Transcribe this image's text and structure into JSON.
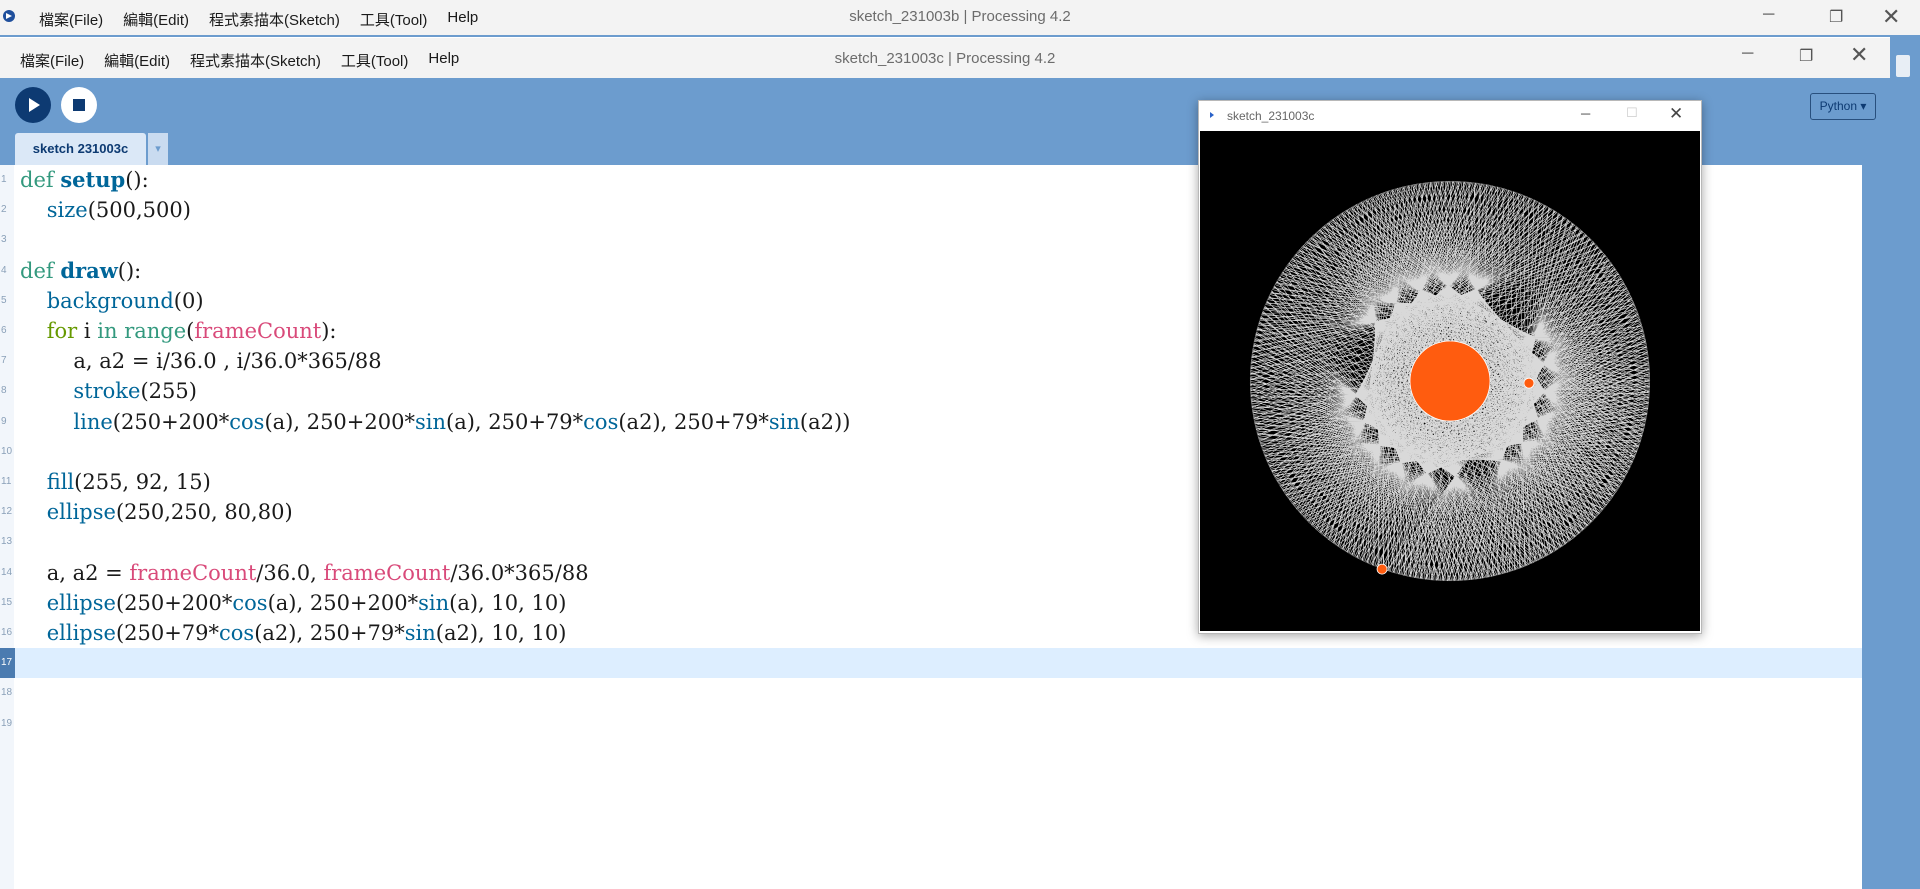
{
  "back_window": {
    "title": "sketch_231003b | Processing 4.2",
    "menu": [
      "檔案(File)",
      "編輯(Edit)",
      "程式素描本(Sketch)",
      "工具(Tool)",
      "Help"
    ],
    "controls": {
      "minimize": "─",
      "maximize": "❐",
      "close": "✕"
    }
  },
  "front_window": {
    "title": "sketch_231003c | Processing 4.2",
    "menu": [
      "檔案(File)",
      "編輯(Edit)",
      "程式素描本(Sketch)",
      "工具(Tool)",
      "Help"
    ],
    "controls": {
      "minimize": "─",
      "maximize": "❐",
      "close": "✕"
    }
  },
  "toolbar": {
    "mode_label": "Python ▾",
    "colors": {
      "bar": "#6c9cce",
      "run": "#0d3a72"
    }
  },
  "tabs": {
    "active_label": "sketch 231003c",
    "menu_arrow": "▾"
  },
  "editor": {
    "current_line": 17,
    "line_numbers": [
      "1",
      "2",
      "3",
      "4",
      "5",
      "6",
      "7",
      "8",
      "9",
      "10",
      "11",
      "12",
      "13",
      "14",
      "15",
      "16",
      "17",
      "18",
      "19"
    ],
    "code": [
      "def setup():",
      "    size(500,500)",
      "",
      "def draw():",
      "    background(0)",
      "    for i in range(frameCount):",
      "        a, a2 = i/36.0 , i/36.0*365/88",
      "        stroke(255)",
      "        line(250+200*cos(a), 250+200*sin(a), 250+79*cos(a2), 250+79*sin(a2))",
      "",
      "    fill(255, 92, 15)",
      "    ellipse(250,250, 80,80)",
      "",
      "    a, a2 = frameCount/36.0, frameCount/36.0*365/88",
      "    ellipse(250+200*cos(a), 250+200*sin(a), 10, 10)",
      "    ellipse(250+79*cos(a2), 250+79*sin(a2), 10, 10)",
      "",
      "",
      ""
    ]
  },
  "sketch_window": {
    "title": "sketch_231003c",
    "controls": {
      "minimize": "─",
      "maximize": "☐",
      "close": "✕"
    },
    "canvas": {
      "background": "#000000",
      "stroke": "#ffffff",
      "fill": "#ff5c0f",
      "frame_count": 1200
    }
  }
}
